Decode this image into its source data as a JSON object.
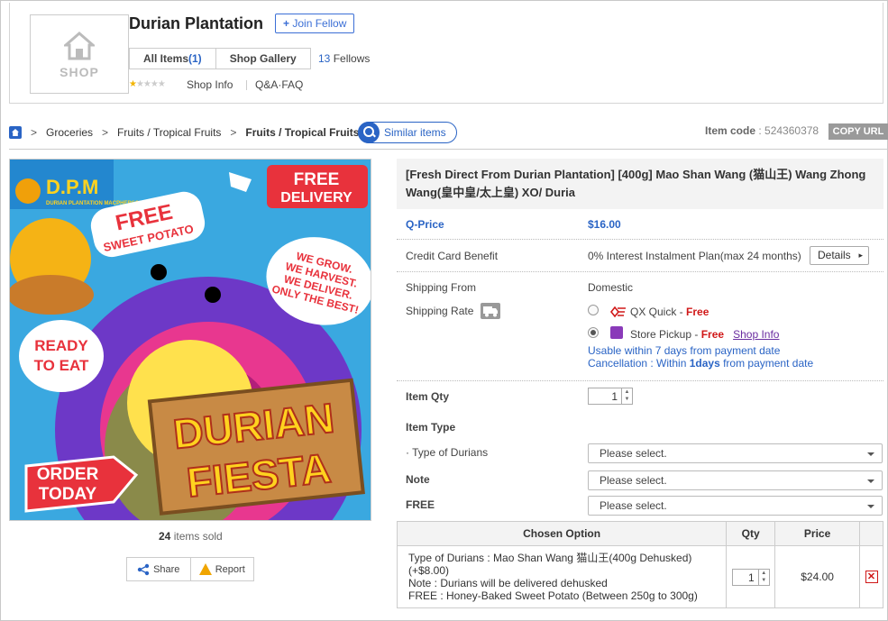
{
  "shop": {
    "logo_text": "SHOP",
    "name": "Durian Plantation",
    "join_label": "Join Fellow",
    "tabs": [
      {
        "label": "All Items",
        "count": "(1)"
      },
      {
        "label": "Shop Gallery"
      }
    ],
    "fellows_count": "13",
    "fellows_label": "Fellows",
    "rating": 1,
    "links": [
      "Shop Info",
      "Q&A·FAQ"
    ]
  },
  "breadcrumb": {
    "items": [
      "Groceries",
      "Fruits / Tropical Fruits",
      "Fruits / Tropical Fruits"
    ],
    "similar_label": "Similar items"
  },
  "item_code": {
    "label": "Item code",
    "value": "524360378",
    "copy_label": "COPY URL"
  },
  "image": {
    "brand": "D.P.M",
    "brand_sub": "DURIAN PLANTATION MACPHERSON",
    "free_delivery": [
      "FREE",
      "DELIVERY"
    ],
    "free_potato": [
      "FREE",
      "SWEET POTATO"
    ],
    "slogan": [
      "WE GROW.",
      "WE HARVEST.",
      "WE DELIVER.",
      "ONLY THE BEST!"
    ],
    "ready": [
      "READY",
      "TO EAT"
    ],
    "order": [
      "ORDER",
      "TODAY"
    ],
    "headline": [
      "DURIAN",
      "FIESTA"
    ]
  },
  "sold": {
    "count": "24",
    "label": "items sold"
  },
  "actions": {
    "share": "Share",
    "report": "Report"
  },
  "product": {
    "title": "[Fresh Direct From Durian Plantation] [400g] Mao Shan Wang (猫山王) Wang Zhong Wang(皇中皇/太上皇) XO/ Duria",
    "qprice_label": "Q-Price",
    "qprice_value": "$16.00",
    "credit_label": "Credit Card Benefit",
    "credit_value": "0% Interest Instalment Plan(max 24 months)",
    "details_label": "Details",
    "ship_from_label": "Shipping From",
    "ship_from_value": "Domestic",
    "ship_rate_label": "Shipping Rate",
    "ship_options": [
      {
        "name": "QX Quick -",
        "price": "Free",
        "selected": false
      },
      {
        "name": "Store Pickup -",
        "price": "Free",
        "link": "Shop Info",
        "selected": true
      }
    ],
    "usable_note": "Usable within 7 days from payment date",
    "cancel_note_pre": "Cancellation : Within ",
    "cancel_note_bold": "1days",
    "cancel_note_post": " from payment date",
    "qty_label": "Item Qty",
    "qty_value": "1",
    "item_type_label": "Item Type",
    "type_durians_label": "· Type of Durians",
    "note_label": "Note",
    "free_label": "FREE",
    "select_placeholder": "Please select."
  },
  "options_table": {
    "headers": [
      "Chosen Option",
      "Qty",
      "Price"
    ],
    "rows": [
      {
        "lines": [
          "Type of Durians : Mao Shan Wang 猫山王(400g Dehusked)",
          "(+$8.00)",
          "Note : Durians will be delivered dehusked",
          "FREE : Honey-Baked Sweet Potato (Between 250g to 300g)"
        ],
        "qty": "1",
        "price": "$24.00"
      }
    ]
  },
  "colors": {
    "accent": "#2a64c5",
    "price_red": "#d01818",
    "link_purple": "#6a2ca0"
  }
}
